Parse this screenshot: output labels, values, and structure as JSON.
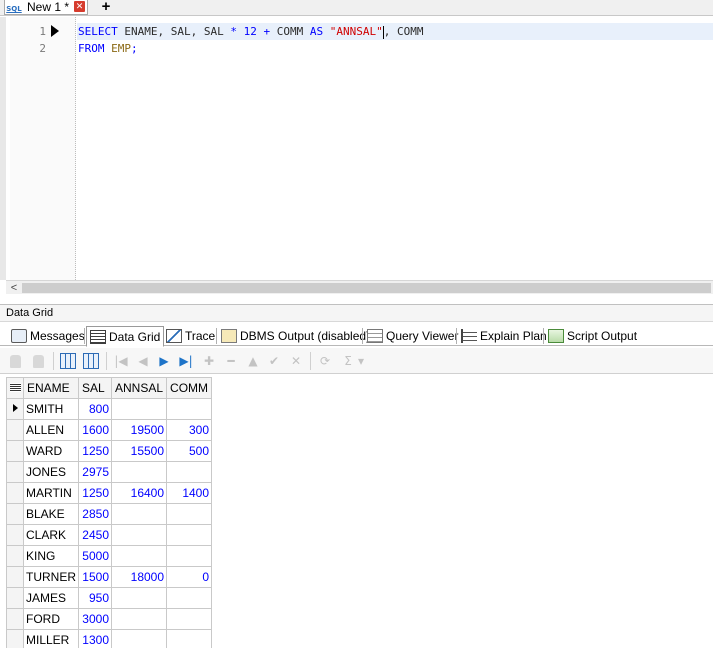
{
  "tabs": {
    "file_icon": "SQL",
    "file_tab_label": "New 1 *",
    "close_glyph": "✕",
    "add_glyph": "+"
  },
  "editor": {
    "lines": [
      {
        "number": "1",
        "tokens": [
          {
            "t": "SELECT",
            "c": "kw"
          },
          {
            "t": " ENAME, SAL, SAL ",
            "c": "id"
          },
          {
            "t": "*",
            "c": "op"
          },
          {
            "t": " ",
            "c": "id"
          },
          {
            "t": "12",
            "c": "num"
          },
          {
            "t": " ",
            "c": "id"
          },
          {
            "t": "+",
            "c": "op"
          },
          {
            "t": " COMM ",
            "c": "id"
          },
          {
            "t": "AS",
            "c": "kw"
          },
          {
            "t": " ",
            "c": "id"
          },
          {
            "t": "\"ANNSAL\"",
            "c": "str"
          },
          {
            "t": "|",
            "c": "caret"
          },
          {
            "t": ", COMM",
            "c": "id"
          }
        ]
      },
      {
        "number": "2",
        "tokens": [
          {
            "t": "FROM",
            "c": "kw"
          },
          {
            "t": " ",
            "c": "id"
          },
          {
            "t": "EMP",
            "c": "tbl"
          },
          {
            "t": ";",
            "c": "op"
          }
        ]
      }
    ],
    "scroll_arrow": "<"
  },
  "panel_title": "Data Grid",
  "result_tabs": [
    {
      "label": "Messages",
      "icon": "messages-icon"
    },
    {
      "label": "Data Grid",
      "icon": "data-grid-icon",
      "active": true
    },
    {
      "label": "Trace",
      "icon": "trace-icon"
    },
    {
      "label": "DBMS Output (disabled)",
      "icon": "dbms-output-icon"
    },
    {
      "label": "Query Viewer",
      "icon": "query-viewer-icon"
    },
    {
      "label": "Explain Plan",
      "icon": "explain-plan-icon"
    },
    {
      "label": "Script Output",
      "icon": "script-output-icon"
    }
  ],
  "toolbar": {
    "first": "|◀",
    "prior": "◀",
    "next": "▶",
    "last": "▶|",
    "insert": "✚",
    "delete": "━",
    "edit": "▲",
    "post": "✔",
    "cancel": "✕",
    "refresh": "⟳",
    "sum": "Σ",
    "dropdown": "▾"
  },
  "grid": {
    "columns": [
      "ENAME",
      "SAL",
      "ANNSAL",
      "COMM"
    ],
    "rows": [
      [
        "SMITH",
        "800",
        "",
        ""
      ],
      [
        "ALLEN",
        "1600",
        "19500",
        "300"
      ],
      [
        "WARD",
        "1250",
        "15500",
        "500"
      ],
      [
        "JONES",
        "2975",
        "",
        ""
      ],
      [
        "MARTIN",
        "1250",
        "16400",
        "1400"
      ],
      [
        "BLAKE",
        "2850",
        "",
        ""
      ],
      [
        "CLARK",
        "2450",
        "",
        ""
      ],
      [
        "KING",
        "5000",
        "",
        ""
      ],
      [
        "TURNER",
        "1500",
        "18000",
        "0"
      ],
      [
        "JAMES",
        "950",
        "",
        ""
      ],
      [
        "FORD",
        "3000",
        "",
        ""
      ],
      [
        "MILLER",
        "1300",
        "",
        ""
      ]
    ]
  }
}
